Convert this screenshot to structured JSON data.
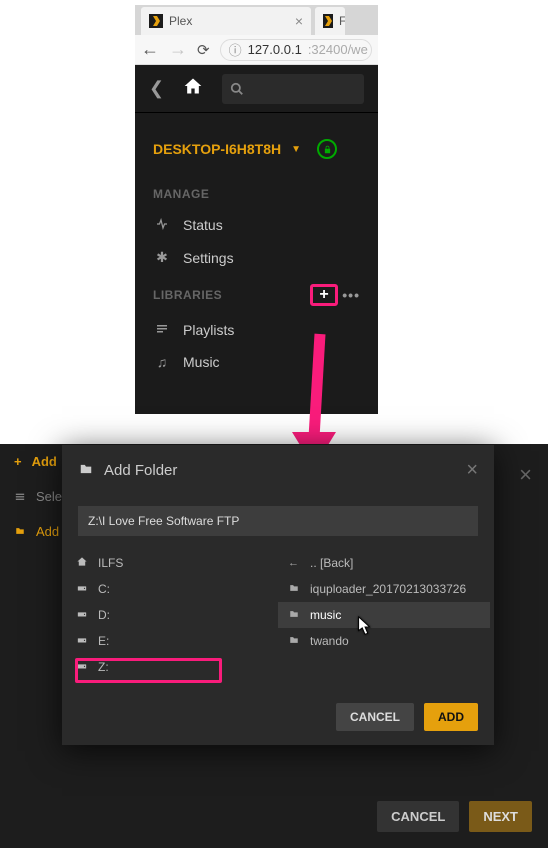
{
  "browser": {
    "tab_title": "Plex",
    "url_ip": "127.0.0.1",
    "url_port": ":32400/we"
  },
  "plex": {
    "server_name": "DESKTOP-I6H8T8H",
    "sections": {
      "manage": "MANAGE",
      "libraries": "LIBRARIES"
    },
    "nav": {
      "status": "Status",
      "settings": "Settings",
      "playlists": "Playlists",
      "music": "Music"
    }
  },
  "backdrop": {
    "add": "Add",
    "select": "Select",
    "addfolder": "Add fo",
    "cancel": "CANCEL",
    "next": "NEXT"
  },
  "modal": {
    "title": "Add Folder",
    "path": "Z:\\I Love Free Software FTP",
    "left": [
      {
        "icon": "home",
        "label": "ILFS"
      },
      {
        "icon": "drive",
        "label": "C:"
      },
      {
        "icon": "drive",
        "label": "D:"
      },
      {
        "icon": "drive",
        "label": "E:"
      },
      {
        "icon": "drive",
        "label": "Z:"
      }
    ],
    "right": [
      {
        "icon": "back",
        "label": ".. [Back]"
      },
      {
        "icon": "folder",
        "label": "iquploader_20170213033726"
      },
      {
        "icon": "folder",
        "label": "music",
        "selected": true
      },
      {
        "icon": "folder",
        "label": "twando"
      }
    ],
    "cancel": "CANCEL",
    "add": "ADD"
  }
}
